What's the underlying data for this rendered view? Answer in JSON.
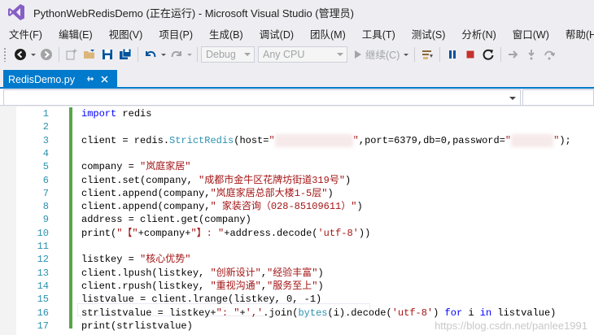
{
  "window": {
    "title": "PythonWebRedisDemo (正在运行) - Microsoft Visual Studio (管理员)"
  },
  "menu": [
    "文件(F)",
    "编辑(E)",
    "视图(V)",
    "项目(P)",
    "生成(B)",
    "调试(D)",
    "团队(M)",
    "工具(T)",
    "测试(S)",
    "分析(N)",
    "窗口(W)",
    "帮助(H)"
  ],
  "toolbar": {
    "config_value": "Debug",
    "platform_value": "Any CPU",
    "continue_label": "继续(C)"
  },
  "tab": {
    "label": "RedisDemo.py"
  },
  "editor": {
    "line_numbers": [
      "1",
      "2",
      "3",
      "4",
      "5",
      "6",
      "7",
      "8",
      "9",
      "10",
      "11",
      "12",
      "13",
      "14",
      "15",
      "16",
      "17"
    ],
    "lines": {
      "l1_kw": "import",
      "l1_rest": " redis",
      "l3_a": "client = redis.",
      "l3_cls": "StrictRedis",
      "l3_b": "(host=",
      "l3_q1": "\"",
      "l3_q2": "\"",
      "l3_c": ",port=6379,db=0,password=",
      "l3_q3": "\"",
      "l3_q4": "\"",
      "l3_end": ");",
      "l5_a": "company = ",
      "l5_str": "\"岚庭家居\"",
      "l6_a": "client.set(company, ",
      "l6_str": "\"成都市金牛区花牌坊街道319号\"",
      "l6_end": ")",
      "l7_a": "client.append(company,",
      "l7_str": "\"岚庭家居总部大楼1-5层\"",
      "l7_end": ")",
      "l8_a": "client.append(company,",
      "l8_str": "\" 家装咨询（028-85109611）\"",
      "l8_end": ")",
      "l9": "address = client.get(company)",
      "l10_a": "print(",
      "l10_s1": "\"【\"",
      "l10_b": "+company+",
      "l10_s2": "\"】: \"",
      "l10_c": "+address.decode(",
      "l10_s3": "'utf-8'",
      "l10_end": "))",
      "l12_a": "listkey = ",
      "l12_str": "\"核心优势\"",
      "l13_a": "client.lpush(listkey, ",
      "l13_s1": "\"创新设计\"",
      "l13_b": ",",
      "l13_s2": "\"经验丰富\"",
      "l13_end": ")",
      "l14_a": "client.rpush(listkey, ",
      "l14_s1": "\"重视沟通\"",
      "l14_b": ",",
      "l14_s2": "\"服务至上\"",
      "l14_end": ")",
      "l15": "listvalue = client.lrange(listkey, 0, -1)",
      "l16_a": "strlistvalue = listkey+",
      "l16_s1": "\": \"",
      "l16_b": "+",
      "l16_s2": "','",
      "l16_c": ".join(",
      "l16_cls": "bytes",
      "l16_d": "(i).decode(",
      "l16_s3": "'utf-8'",
      "l16_e": ") ",
      "l16_kw1": "for",
      "l16_f": " i ",
      "l16_kw2": "in",
      "l16_g": " listvalue)",
      "l17": "print(strlistvalue)"
    },
    "watermark": "https://blog.csdn.net/panlee1991"
  },
  "colors": {
    "accent": "#007acc",
    "change_bar": "#57a64a"
  }
}
